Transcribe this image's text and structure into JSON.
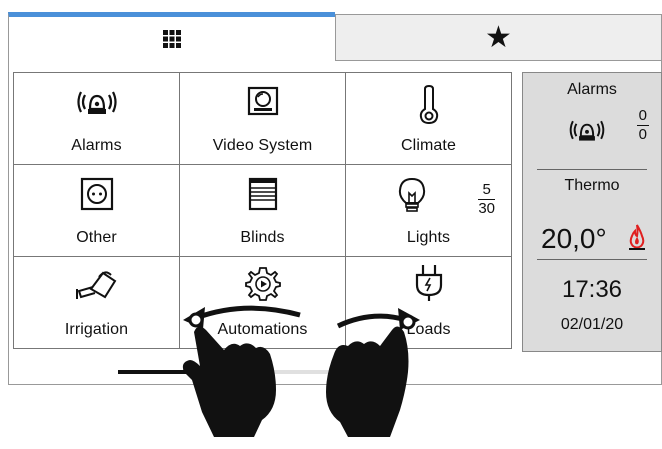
{
  "tabs": [
    {
      "name": "grid",
      "icon": "grid-icon",
      "active": true
    },
    {
      "name": "favorites",
      "icon": "star-icon",
      "active": false
    }
  ],
  "tiles": [
    {
      "label": "Alarms",
      "icon": "alarm-siren-icon"
    },
    {
      "label": "Video System",
      "icon": "intercom-camera-icon"
    },
    {
      "label": "Climate",
      "icon": "thermometer-icon"
    },
    {
      "label": "Other",
      "icon": "power-socket-icon"
    },
    {
      "label": "Blinds",
      "icon": "blinds-icon"
    },
    {
      "label": "Lights",
      "icon": "light-bulb-icon",
      "count_on": "5",
      "count_total": "30"
    },
    {
      "label": "Irrigation",
      "icon": "watering-can-icon"
    },
    {
      "label": "Automations",
      "icon": "gear-play-icon"
    },
    {
      "label": "Loads",
      "icon": "plug-icon"
    }
  ],
  "panel": {
    "alarms_title": "Alarms",
    "alarms_active": "0",
    "alarms_total": "0",
    "thermo_title": "Thermo",
    "temperature": "20,0°",
    "time": "17:36",
    "date": "02/01/20"
  },
  "scroll": {
    "position_fraction": 0.0,
    "thumb_fraction": 0.34
  },
  "gesture": {
    "type": "two-finger-swipe",
    "icons": [
      "hand-left-icon",
      "hand-right-icon",
      "swipe-arrow-left-icon",
      "swipe-arrow-right-icon"
    ]
  },
  "colors": {
    "active_tab_accent": "#4a90d9",
    "flame": "#e02020",
    "panel_bg": "#dcdcdc"
  }
}
